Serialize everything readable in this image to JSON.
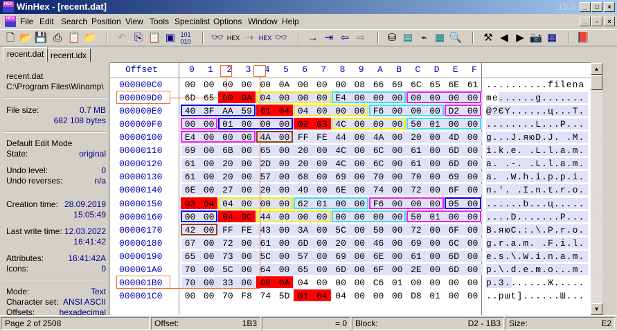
{
  "window": {
    "title": "WinHex - [recent.dat]",
    "version": "15.0"
  },
  "menu": [
    "File",
    "Edit",
    "Search",
    "Position",
    "View",
    "Tools",
    "Specialist",
    "Options",
    "Window",
    "Help"
  ],
  "tabs": [
    "recent.dat",
    "recent.idx"
  ],
  "info": {
    "filename": "recent.dat",
    "path": "C:\\Program Files\\Winamp\\",
    "file_size_label": "File size:",
    "file_size_mb": "0.7 MB",
    "file_size_bytes": "682 108 bytes",
    "edit_mode": "Default Edit Mode",
    "state_label": "State:",
    "state": "original",
    "undo_level_label": "Undo level:",
    "undo_level": "0",
    "undo_rev_label": "Undo reverses:",
    "undo_rev": "n/a",
    "creation_label": "Creation time:",
    "creation_date": "28.09.2019",
    "creation_time": "15:05:49",
    "write_label": "Last write time:",
    "write_date": "12.03.2022",
    "write_time": "16:41:42",
    "attr_label": "Attributes:",
    "attr": "16:41:42A",
    "icons_label": "Icons:",
    "icons": "0",
    "mode_label": "Mode:",
    "mode": "Text",
    "charset_label": "Character set:",
    "charset": "ANSI ASCII",
    "offsets_label": "Offsets:",
    "offsets": "hexadecimal"
  },
  "hex": {
    "offset_header": "Offset",
    "columns": [
      "0",
      "1",
      "2",
      "3",
      "4",
      "5",
      "6",
      "7",
      "8",
      "9",
      "A",
      "B",
      "C",
      "D",
      "E",
      "F"
    ],
    "rows": [
      {
        "off": "000000C0",
        "bytes": "00 00 00 00 00 0A 00 00 00 08 66 69 6C 65 6E 61",
        "text": "..........filena"
      },
      {
        "off": "000000D0",
        "bytes": "6D 65 00 0A 04 00 00 00 E4 00 00 00 00 00 00 00",
        "text": "me......g......."
      },
      {
        "off": "000000E0",
        "bytes": "40 3F AA 59 01 04 04 00 00 00 F6 00 00 00 D2 00",
        "text": "@?ЄY......ц...T."
      },
      {
        "off": "000000F0",
        "bytes": "00 00 01 00 00 00 02 03 4C 00 00 00 50 01 00 00",
        "text": "........L...P..."
      },
      {
        "off": "00000100",
        "bytes": "E4 00 00 00 4A 00 FF FE 44 00 4A 00 20 00 4D 00",
        "text": "g...J.яюD.J. .M."
      },
      {
        "off": "00000110",
        "bytes": "69 00 6B 00 65 00 20 00 4C 00 6C 00 61 00 6D 00",
        "text": "i.k.e. .L.l.a.m."
      },
      {
        "off": "00000120",
        "bytes": "61 00 20 00 2D 00 20 00 4C 00 6C 00 61 00 6D 00",
        "text": "a. .-. .L.l.a.m."
      },
      {
        "off": "00000130",
        "bytes": "61 00 20 00 57 00 68 00 69 00 70 00 70 00 69 00",
        "text": "a. .W.h.i.p.p.i."
      },
      {
        "off": "00000140",
        "bytes": "6E 00 27 00 20 00 49 00 6E 00 74 00 72 00 6F 00",
        "text": "n.'. .I.n.t.r.o."
      },
      {
        "off": "00000150",
        "bytes": "03 04 04 00 00 00 62 01 00 00 F6 00 00 00 05 00",
        "text": "......b...ц....."
      },
      {
        "off": "00000160",
        "bytes": "00 00 04 0C 44 00 00 00 00 00 00 00 50 01 00 00",
        "text": "....D.......P..."
      },
      {
        "off": "00000170",
        "bytes": "42 00 FF FE 43 00 3A 00 5C 00 50 00 72 00 6F 00",
        "text": "B.яюC.:.\\.P.r.o."
      },
      {
        "off": "00000180",
        "bytes": "67 00 72 00 61 00 6D 00 20 00 46 00 69 00 6C 00",
        "text": "g.r.a.m. .F.i.l."
      },
      {
        "off": "00000190",
        "bytes": "65 00 73 00 5C 00 57 00 69 00 6E 00 61 00 6D 00",
        "text": "e.s.\\.W.i.n.a.m."
      },
      {
        "off": "000001A0",
        "bytes": "70 00 5C 00 64 00 65 00 6D 00 6F 00 2E 00 6D 00",
        "text": "p.\\.d.e.m.o...m."
      },
      {
        "off": "000001B0",
        "bytes": "70 00 33 00 00 0A 04 00 00 00 C6 01 00 00 00 00",
        "text": "p.3.......Ж....."
      },
      {
        "off": "000001C0",
        "bytes": "00 00 70 F8 74 5D 01 04 04 00 00 00 D8 01 00 00",
        "text": "..pшt]......Ш..."
      }
    ],
    "colors": {
      "red": "#ff0000",
      "yellow": "#f0f000",
      "cyan": "#40e0f0",
      "magenta": "#f020f0",
      "blue": "#0000e0",
      "brown": "#8b4513",
      "highlight": "#e0e0f8",
      "marker": "#f07030"
    },
    "marks": [
      [
        1,
        2,
        2,
        "red"
      ],
      [
        1,
        4,
        4,
        "yellow"
      ],
      [
        1,
        8,
        4,
        "cyan"
      ],
      [
        1,
        12,
        4,
        "magenta"
      ],
      [
        2,
        0,
        4,
        "blue"
      ],
      [
        2,
        4,
        2,
        "red"
      ],
      [
        2,
        6,
        4,
        "yellow"
      ],
      [
        2,
        10,
        4,
        "cyan"
      ],
      [
        2,
        14,
        2,
        "magenta"
      ],
      [
        3,
        0,
        2,
        "magenta"
      ],
      [
        3,
        2,
        4,
        "blue"
      ],
      [
        3,
        6,
        2,
        "red"
      ],
      [
        3,
        8,
        4,
        "yellow"
      ],
      [
        3,
        12,
        4,
        "cyan"
      ],
      [
        4,
        0,
        4,
        "magenta"
      ],
      [
        4,
        4,
        2,
        "brown"
      ],
      [
        9,
        0,
        2,
        "red"
      ],
      [
        9,
        2,
        4,
        "yellow"
      ],
      [
        9,
        6,
        4,
        "cyan"
      ],
      [
        9,
        10,
        4,
        "magenta"
      ],
      [
        9,
        14,
        2,
        "blue"
      ],
      [
        10,
        0,
        2,
        "blue"
      ],
      [
        10,
        2,
        2,
        "red"
      ],
      [
        10,
        4,
        4,
        "yellow"
      ],
      [
        10,
        8,
        4,
        "cyan"
      ],
      [
        10,
        12,
        4,
        "magenta"
      ],
      [
        11,
        0,
        2,
        "brown"
      ],
      [
        15,
        4,
        2,
        "red"
      ],
      [
        16,
        6,
        2,
        "red"
      ]
    ]
  },
  "status": {
    "page": "Page 2 of 2508",
    "offset_label": "Offset:",
    "offset": "1B3",
    "eq": "= 0",
    "block_label": "Block:",
    "block": "D2 - 1B3",
    "size_label": "Size:",
    "size": "E2"
  }
}
